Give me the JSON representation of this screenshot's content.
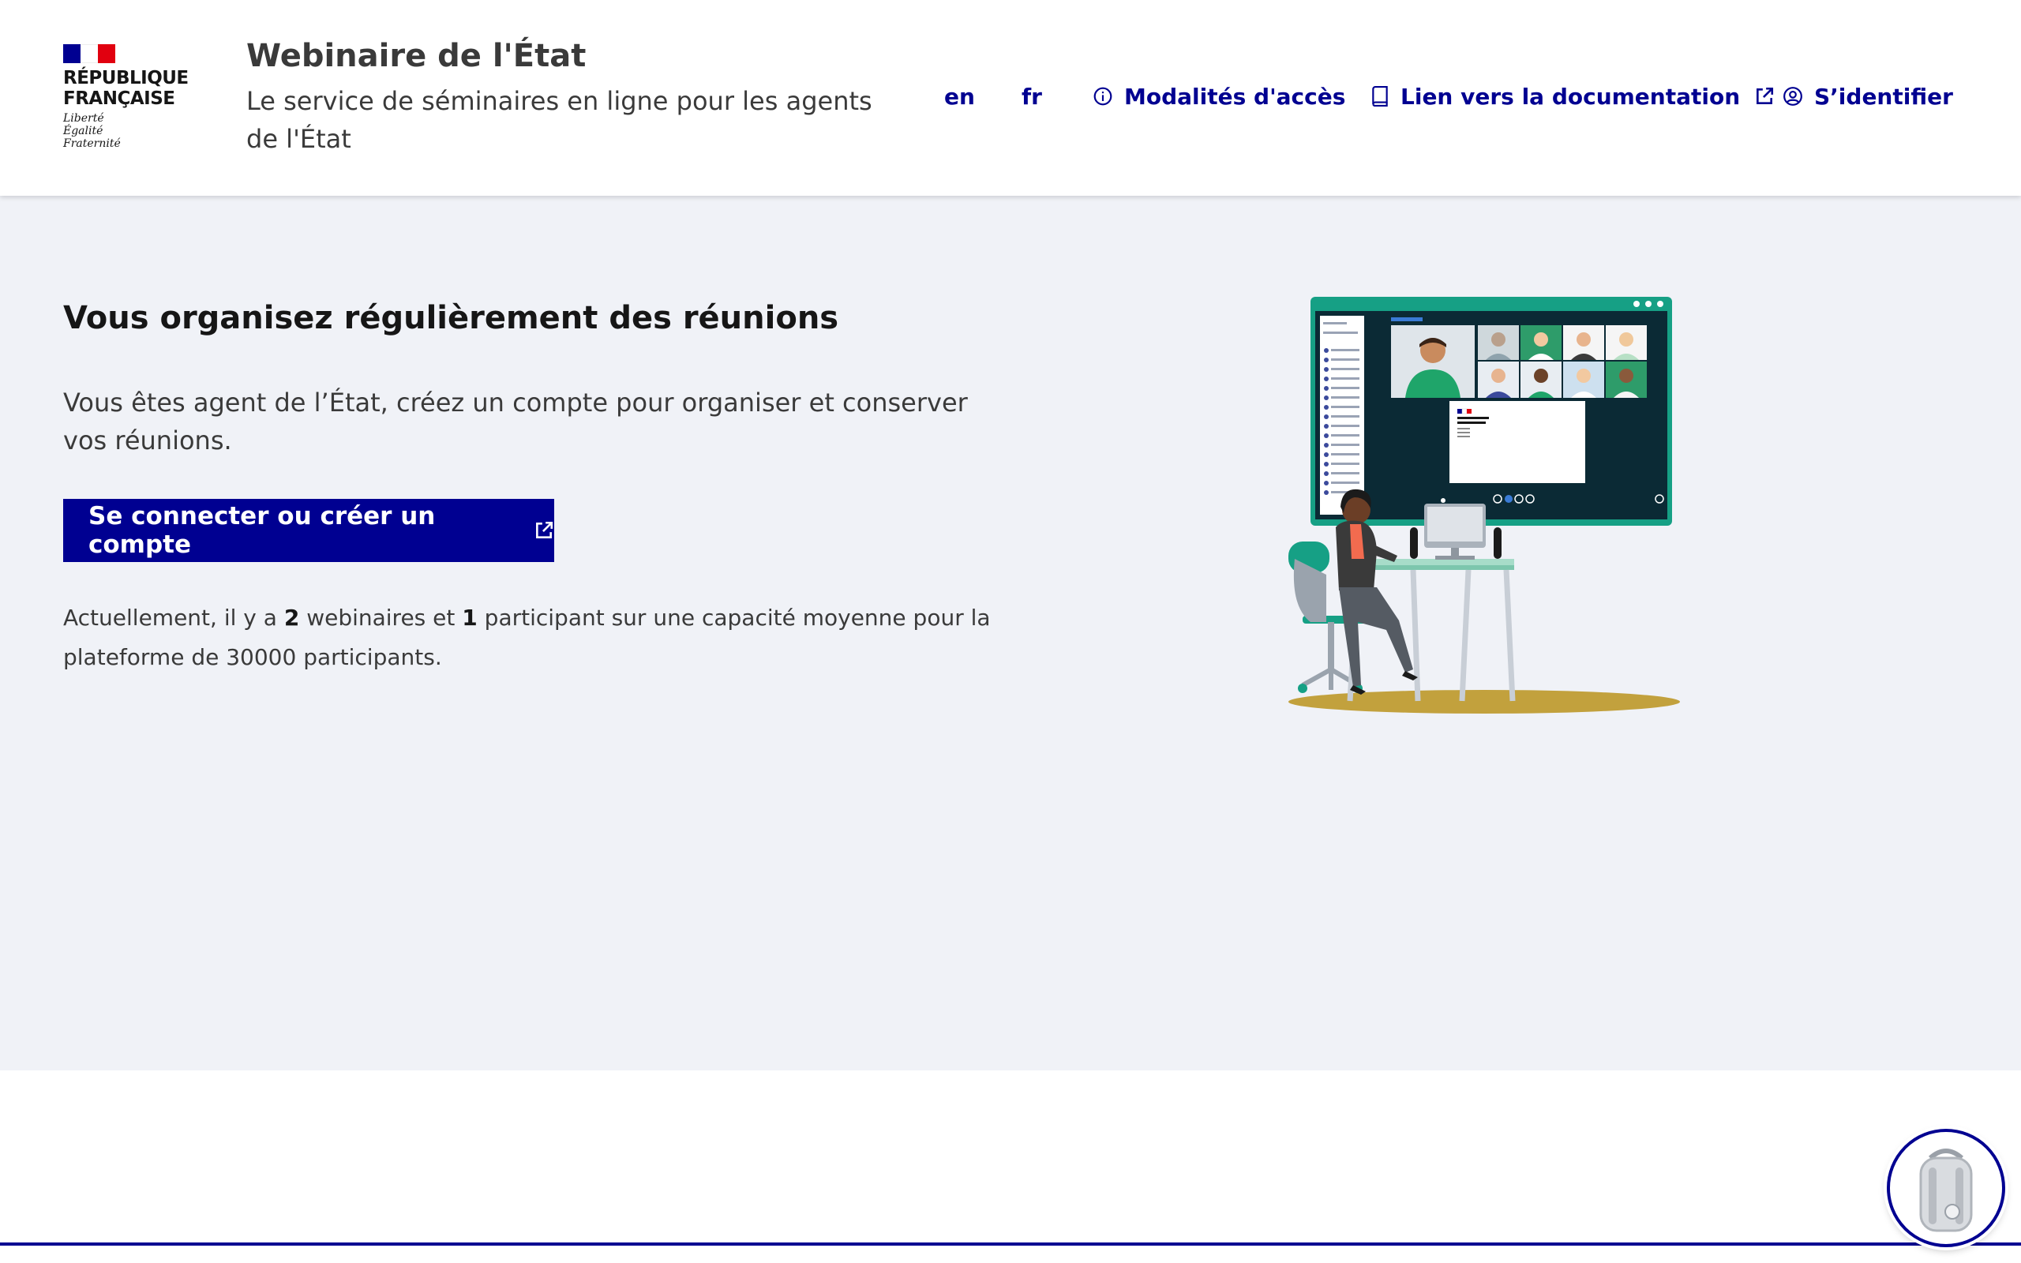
{
  "header": {
    "logo": {
      "name": "RÉPUBLIQUE\nFRANÇAISE",
      "motto": "Liberté\nÉgalité\nFraternité"
    },
    "service_title": "Webinaire de l'État",
    "service_tagline": "Le service de séminaires en ligne pour les agents de l'État",
    "nav": {
      "lang_en": "en",
      "lang_fr": "fr",
      "access_label": "Modalités d'accès",
      "access_icon": "info-icon",
      "doc_label": "Lien vers la documentation",
      "doc_icon": "book-icon",
      "login_label": "S’identifier",
      "login_icon": "user-circle-icon"
    }
  },
  "main": {
    "title": "Vous organisez régulièrement des réunions",
    "text": "Vous êtes agent de l’État, créez un compte pour organiser et conserver vos réunions.",
    "cta_label": "Se connecter ou créer un compte",
    "stats": {
      "prefix": "Actuellement, il y a ",
      "webinars_count": "2",
      "middle": " webinaires et ",
      "participants_count": "1",
      "suffix": " participant sur une capacité moyenne pour la plateforme de 30000 participants."
    },
    "illustration": {
      "screen_logo_text": "RÉPUBLIQUE\nFRANÇAISE"
    }
  },
  "colors": {
    "primary_blue": "#000091",
    "marianne_red": "#e1000f",
    "page_bg": "#f0f2f7",
    "screen_frame": "#16a085",
    "desk_shadow": "#c2a13d"
  }
}
